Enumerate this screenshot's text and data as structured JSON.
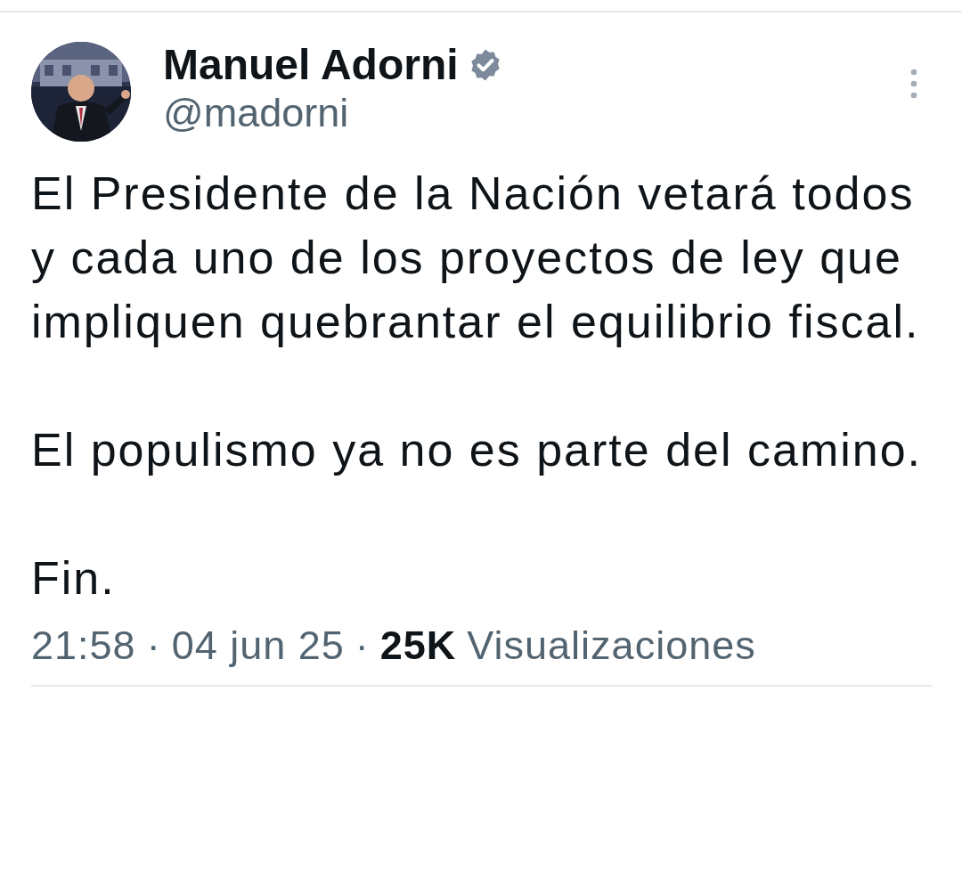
{
  "author": {
    "name": "Manuel Adorni",
    "handle": "@madorni",
    "verified": true
  },
  "paragraphs": [
    "El Presidente de la Nación vetará todos y cada uno de los proyectos de ley que impliquen quebrantar el equilibrio fiscal.",
    "El populismo ya no es parte del camino.",
    "Fin."
  ],
  "meta": {
    "time": "21:58",
    "separator": "·",
    "date": "04 jun 25",
    "views_count": "25K",
    "views_label": "Visualizaciones"
  }
}
